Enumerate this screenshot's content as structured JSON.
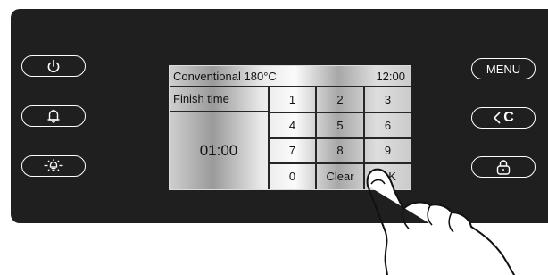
{
  "panel": {
    "left_buttons": [
      {
        "icon": "power-icon"
      },
      {
        "icon": "bell-icon"
      },
      {
        "icon": "oven-light-icon"
      }
    ],
    "right_buttons": [
      {
        "label": "MENU"
      },
      {
        "label": "C",
        "icon": "back-arrow-icon"
      },
      {
        "icon": "lock-icon"
      }
    ]
  },
  "screen": {
    "mode": "Conventional 180°C",
    "clock": "12:00",
    "finish_label": "Finish time",
    "finish_value": "01:00",
    "keys": [
      "1",
      "2",
      "3",
      "4",
      "5",
      "6",
      "7",
      "8",
      "9",
      "0",
      "Clear",
      "OK"
    ]
  },
  "colors": {
    "panel_bg": "#1f1f1f",
    "button_border": "#ffffff",
    "screen_line": "#262626"
  }
}
